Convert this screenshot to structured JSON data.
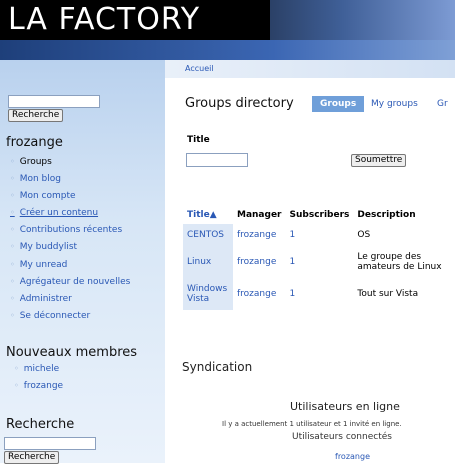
{
  "header": {
    "logo": "LA FACTORY"
  },
  "sidebar": {
    "search_button": "Recherche",
    "user_heading": "frozange",
    "nav_items": [
      {
        "label": "Groups",
        "active": true
      },
      {
        "label": "Mon blog"
      },
      {
        "label": "Mon compte"
      },
      {
        "label": "Créer un contenu"
      },
      {
        "label": "Contributions récentes"
      },
      {
        "label": "My buddylist"
      },
      {
        "label": "My unread"
      },
      {
        "label": "Agrégateur de nouvelles"
      },
      {
        "label": "Administrer"
      },
      {
        "label": "Se déconnecter"
      }
    ],
    "new_members_heading": "Nouveaux membres",
    "new_members": [
      "michele",
      "frozange"
    ],
    "search_heading": "Recherche",
    "search_button_2": "Recherche"
  },
  "main": {
    "breadcrumb": "Accueil",
    "title": "Groups directory",
    "tabs": [
      {
        "label": "Groups",
        "active": true
      },
      {
        "label": "My groups"
      },
      {
        "label": "Gr"
      }
    ],
    "filter": {
      "label": "Title",
      "submit": "Soumettre"
    },
    "table": {
      "headers": [
        "Title▲",
        "Manager",
        "Subscribers",
        "Description"
      ],
      "rows": [
        [
          "CENTOS",
          "frozange",
          "1",
          "OS"
        ],
        [
          "Linux",
          "frozange",
          "1",
          "Le groupe des amateurs de Linux"
        ],
        [
          "Windows Vista",
          "frozange",
          "1",
          "Tout sur Vista"
        ]
      ]
    },
    "syndication": "Syndication",
    "online": {
      "heading": "Utilisateurs en ligne",
      "text": "Il y a actuellement 1 utilisateur et 1 invité en ligne.",
      "connected_heading": "Utilisateurs connectés",
      "user": "frozange"
    }
  }
}
